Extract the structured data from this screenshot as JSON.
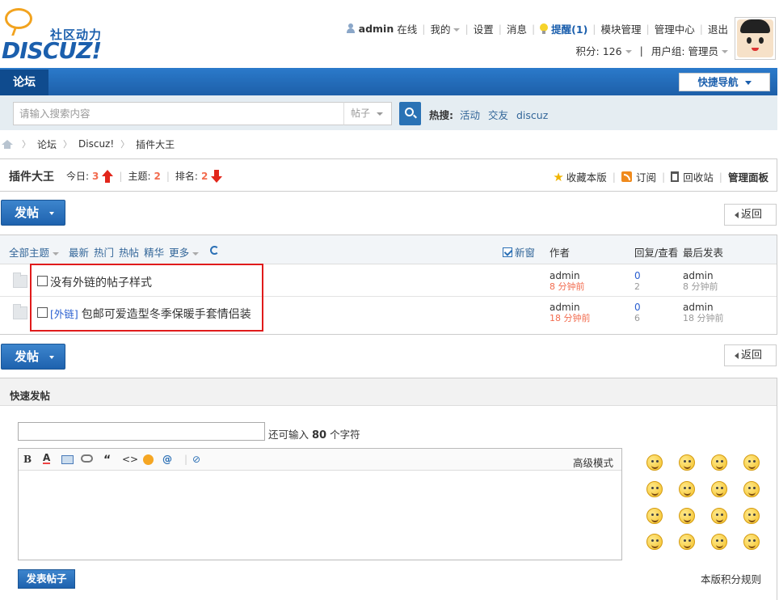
{
  "header": {
    "logo_cn": "社区动力",
    "logo_en": "DISCUZ!",
    "username": "admin",
    "online": "在线",
    "my": "我的",
    "settings": "设置",
    "messages": "消息",
    "reminder": "提醒(1)",
    "module_manage": "模块管理",
    "admin_center": "管理中心",
    "logout": "退出",
    "credits_label": "积分: 126",
    "usergroup_label": "用户组: 管理员"
  },
  "nav": {
    "forum_tab": "论坛",
    "quick_nav": "快捷导航"
  },
  "search": {
    "placeholder": "请输入搜索内容",
    "type": "帖子",
    "hot_label": "热搜:",
    "hot_words": [
      "活动",
      "交友",
      "discuz"
    ]
  },
  "breadcrumb": [
    "论坛",
    "Discuz!",
    "插件大王"
  ],
  "forum": {
    "title": "插件大王",
    "today_label": "今日:",
    "today": "3",
    "topics_label": "主题:",
    "topics": "2",
    "rank_label": "排名:",
    "rank": "2",
    "favorite": "收藏本版",
    "subscribe": "订阅",
    "recycle": "回收站",
    "admin_panel": "管理面板"
  },
  "buttons": {
    "post": "发帖",
    "back": "返回"
  },
  "filters": [
    "全部主题",
    "最新",
    "热门",
    "热帖",
    "精华",
    "更多"
  ],
  "columns": {
    "new_window": "新窗",
    "author": "作者",
    "replies_views": "回复/查看",
    "last_post": "最后发表"
  },
  "threads": [
    {
      "tag": "",
      "title": "没有外链的帖子样式",
      "author": "admin",
      "time": "8 分钟前",
      "replies": "0",
      "views": "2",
      "last_author": "admin",
      "last_time": "8 分钟前"
    },
    {
      "tag": "[外链]",
      "title": "包邮可爱造型冬季保暖手套情侣装",
      "author": "admin",
      "time": "18 分钟前",
      "replies": "0",
      "views": "6",
      "last_author": "admin",
      "last_time": "18 分钟前"
    }
  ],
  "quickpost": {
    "title": "快速发帖",
    "char_hint_pre": "还可输入",
    "char_count": "80",
    "char_hint_post": "个字符",
    "advanced": "高级模式",
    "submit": "发表帖子",
    "credit_rules": "本版积分规则"
  },
  "colors": {
    "brand_blue": "#1d5fa8",
    "accent_orange": "#f26c4f",
    "highlight_red": "#e01b1b"
  }
}
